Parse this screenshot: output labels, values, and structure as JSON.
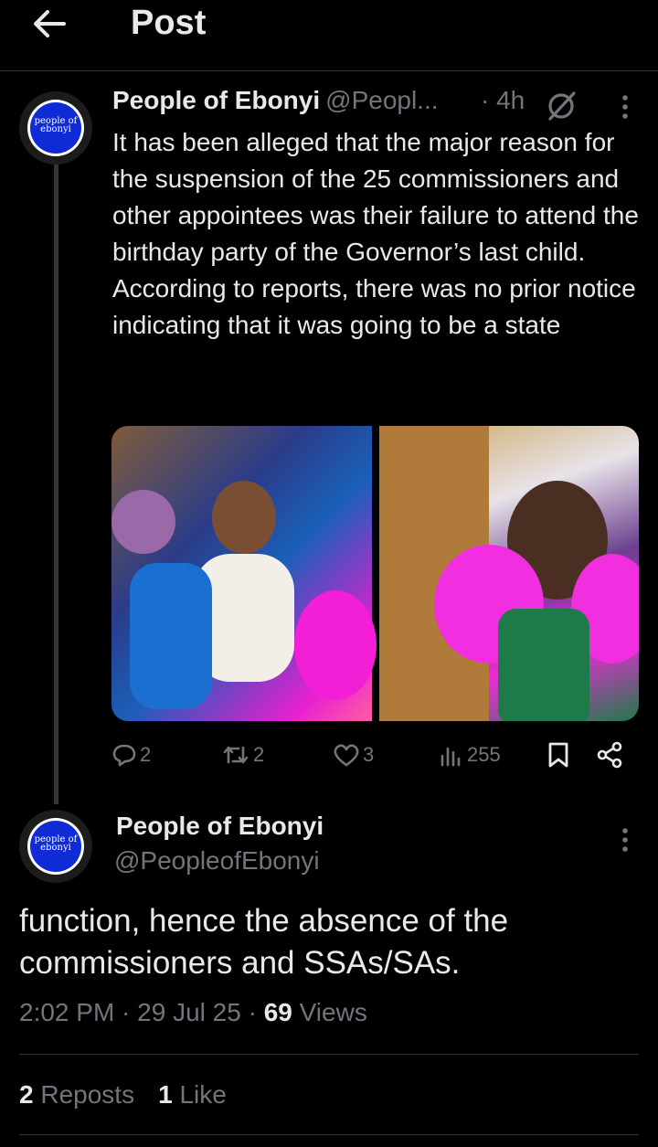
{
  "header": {
    "title": "Post"
  },
  "post": {
    "avatar_text_line1": "people of",
    "avatar_text_line2": "ebonyi",
    "author_name": "People of Ebonyi",
    "author_handle": "@Peopl...",
    "time": "· 4h",
    "text": "It has been alleged that the major reason for the suspension of the 25 commissioners and other appointees was their failure to attend the birthday party of the Governor’s last child. According to reports, there was no prior notice indicating that it was going to be a state",
    "stats": {
      "replies": "2",
      "reposts": "2",
      "likes": "3",
      "views": "255"
    }
  },
  "reply": {
    "avatar_text_line1": "people of",
    "avatar_text_line2": "ebonyi",
    "author_name": "People of Ebonyi",
    "author_handle": "@PeopleofEbonyi",
    "text": "function, hence the absence of the commissioners and SSAs/SAs.",
    "time": "2:02 PM",
    "date": "29 Jul 25",
    "views_count": "69",
    "views_label": "Views",
    "reposts_count": "2",
    "reposts_label": "Reposts",
    "likes_count": "1",
    "likes_label": "Like"
  },
  "colors": {
    "background": "#000000",
    "text_primary": "#e7e9ea",
    "text_secondary": "#71767b",
    "divider": "#2f3336",
    "avatar_blue": "#0f2bd6"
  },
  "icons": [
    "back-arrow-icon",
    "grok-icon",
    "more-icon",
    "reply-icon",
    "repost-icon",
    "like-icon",
    "views-icon",
    "bookmark-icon",
    "share-icon"
  ]
}
